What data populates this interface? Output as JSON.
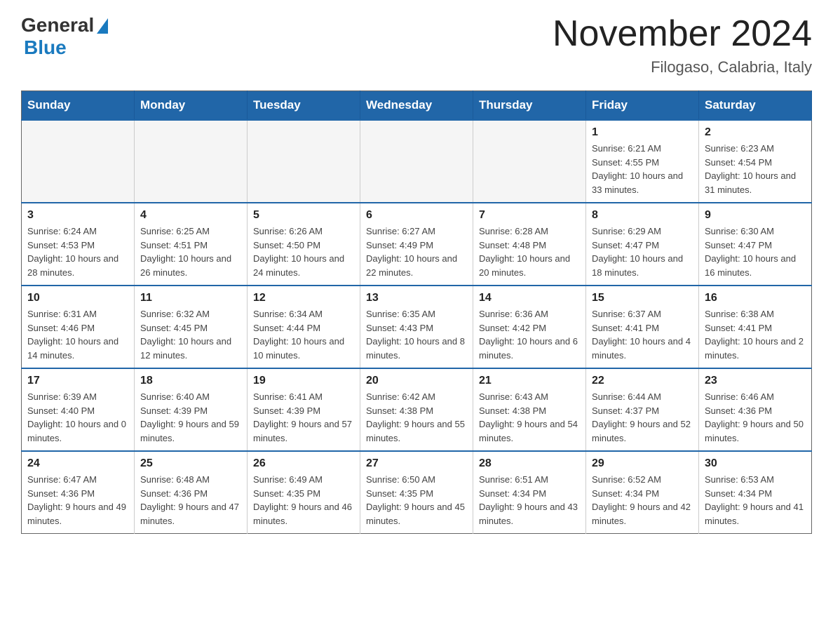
{
  "logo": {
    "general": "General",
    "blue": "Blue"
  },
  "header": {
    "title": "November 2024",
    "subtitle": "Filogaso, Calabria, Italy"
  },
  "weekdays": [
    "Sunday",
    "Monday",
    "Tuesday",
    "Wednesday",
    "Thursday",
    "Friday",
    "Saturday"
  ],
  "weeks": [
    [
      {
        "day": "",
        "info": ""
      },
      {
        "day": "",
        "info": ""
      },
      {
        "day": "",
        "info": ""
      },
      {
        "day": "",
        "info": ""
      },
      {
        "day": "",
        "info": ""
      },
      {
        "day": "1",
        "info": "Sunrise: 6:21 AM\nSunset: 4:55 PM\nDaylight: 10 hours and 33 minutes."
      },
      {
        "day": "2",
        "info": "Sunrise: 6:23 AM\nSunset: 4:54 PM\nDaylight: 10 hours and 31 minutes."
      }
    ],
    [
      {
        "day": "3",
        "info": "Sunrise: 6:24 AM\nSunset: 4:53 PM\nDaylight: 10 hours and 28 minutes."
      },
      {
        "day": "4",
        "info": "Sunrise: 6:25 AM\nSunset: 4:51 PM\nDaylight: 10 hours and 26 minutes."
      },
      {
        "day": "5",
        "info": "Sunrise: 6:26 AM\nSunset: 4:50 PM\nDaylight: 10 hours and 24 minutes."
      },
      {
        "day": "6",
        "info": "Sunrise: 6:27 AM\nSunset: 4:49 PM\nDaylight: 10 hours and 22 minutes."
      },
      {
        "day": "7",
        "info": "Sunrise: 6:28 AM\nSunset: 4:48 PM\nDaylight: 10 hours and 20 minutes."
      },
      {
        "day": "8",
        "info": "Sunrise: 6:29 AM\nSunset: 4:47 PM\nDaylight: 10 hours and 18 minutes."
      },
      {
        "day": "9",
        "info": "Sunrise: 6:30 AM\nSunset: 4:47 PM\nDaylight: 10 hours and 16 minutes."
      }
    ],
    [
      {
        "day": "10",
        "info": "Sunrise: 6:31 AM\nSunset: 4:46 PM\nDaylight: 10 hours and 14 minutes."
      },
      {
        "day": "11",
        "info": "Sunrise: 6:32 AM\nSunset: 4:45 PM\nDaylight: 10 hours and 12 minutes."
      },
      {
        "day": "12",
        "info": "Sunrise: 6:34 AM\nSunset: 4:44 PM\nDaylight: 10 hours and 10 minutes."
      },
      {
        "day": "13",
        "info": "Sunrise: 6:35 AM\nSunset: 4:43 PM\nDaylight: 10 hours and 8 minutes."
      },
      {
        "day": "14",
        "info": "Sunrise: 6:36 AM\nSunset: 4:42 PM\nDaylight: 10 hours and 6 minutes."
      },
      {
        "day": "15",
        "info": "Sunrise: 6:37 AM\nSunset: 4:41 PM\nDaylight: 10 hours and 4 minutes."
      },
      {
        "day": "16",
        "info": "Sunrise: 6:38 AM\nSunset: 4:41 PM\nDaylight: 10 hours and 2 minutes."
      }
    ],
    [
      {
        "day": "17",
        "info": "Sunrise: 6:39 AM\nSunset: 4:40 PM\nDaylight: 10 hours and 0 minutes."
      },
      {
        "day": "18",
        "info": "Sunrise: 6:40 AM\nSunset: 4:39 PM\nDaylight: 9 hours and 59 minutes."
      },
      {
        "day": "19",
        "info": "Sunrise: 6:41 AM\nSunset: 4:39 PM\nDaylight: 9 hours and 57 minutes."
      },
      {
        "day": "20",
        "info": "Sunrise: 6:42 AM\nSunset: 4:38 PM\nDaylight: 9 hours and 55 minutes."
      },
      {
        "day": "21",
        "info": "Sunrise: 6:43 AM\nSunset: 4:38 PM\nDaylight: 9 hours and 54 minutes."
      },
      {
        "day": "22",
        "info": "Sunrise: 6:44 AM\nSunset: 4:37 PM\nDaylight: 9 hours and 52 minutes."
      },
      {
        "day": "23",
        "info": "Sunrise: 6:46 AM\nSunset: 4:36 PM\nDaylight: 9 hours and 50 minutes."
      }
    ],
    [
      {
        "day": "24",
        "info": "Sunrise: 6:47 AM\nSunset: 4:36 PM\nDaylight: 9 hours and 49 minutes."
      },
      {
        "day": "25",
        "info": "Sunrise: 6:48 AM\nSunset: 4:36 PM\nDaylight: 9 hours and 47 minutes."
      },
      {
        "day": "26",
        "info": "Sunrise: 6:49 AM\nSunset: 4:35 PM\nDaylight: 9 hours and 46 minutes."
      },
      {
        "day": "27",
        "info": "Sunrise: 6:50 AM\nSunset: 4:35 PM\nDaylight: 9 hours and 45 minutes."
      },
      {
        "day": "28",
        "info": "Sunrise: 6:51 AM\nSunset: 4:34 PM\nDaylight: 9 hours and 43 minutes."
      },
      {
        "day": "29",
        "info": "Sunrise: 6:52 AM\nSunset: 4:34 PM\nDaylight: 9 hours and 42 minutes."
      },
      {
        "day": "30",
        "info": "Sunrise: 6:53 AM\nSunset: 4:34 PM\nDaylight: 9 hours and 41 minutes."
      }
    ]
  ]
}
